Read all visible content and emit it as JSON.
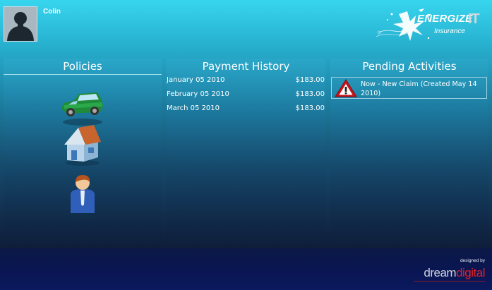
{
  "header": {
    "user_name": "Colin",
    "logo": {
      "word1": "ENERGIZE",
      "word2": "IT",
      "sub": "Insurance"
    }
  },
  "panels": {
    "policies": {
      "title": "Policies",
      "items": [
        {
          "icon": "car-icon"
        },
        {
          "icon": "house-icon"
        },
        {
          "icon": "person-icon"
        }
      ]
    },
    "payment_history": {
      "title": "Payment History",
      "rows": [
        {
          "date": "January 05 2010",
          "amount": "$183.00"
        },
        {
          "date": "February 05 2010",
          "amount": "$183.00"
        },
        {
          "date": "March 05 2010",
          "amount": "$183.00"
        }
      ]
    },
    "pending_activities": {
      "title": "Pending Activities",
      "items": [
        {
          "icon": "warning-icon",
          "text": "Now - New Claim (Created May 14 2010)"
        }
      ]
    }
  },
  "footer": {
    "designed_by": "designed by",
    "brand_part1": "dream",
    "brand_part2": "digital",
    "brand_colors": {
      "part1": "#cfd3da",
      "part2": "#e0202a"
    }
  }
}
